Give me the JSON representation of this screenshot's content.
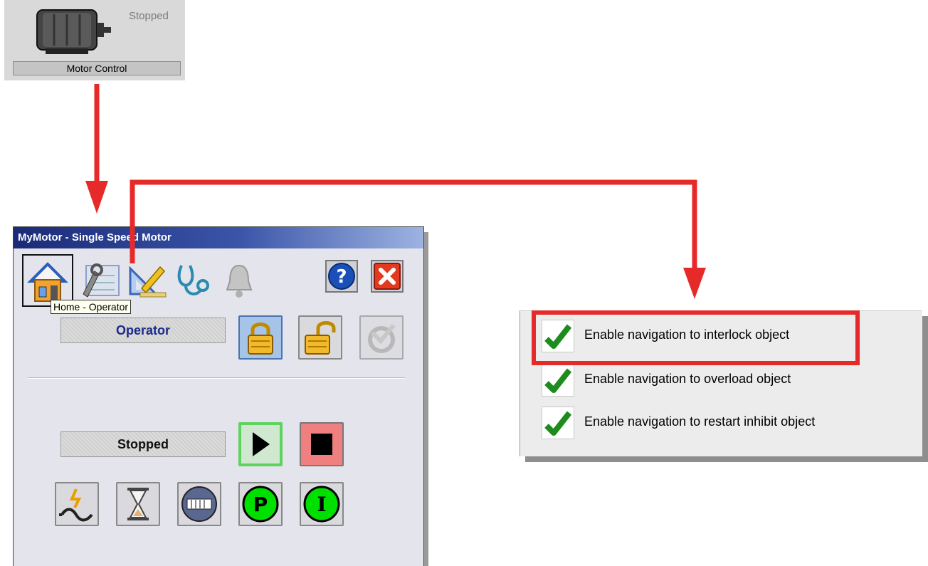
{
  "motor_tile": {
    "status": "Stopped",
    "label": "Motor Control"
  },
  "faceplate": {
    "title": "MyMotor - Single Speed Motor",
    "tabs": [
      {
        "name": "home-icon"
      },
      {
        "name": "maintenance-icon"
      },
      {
        "name": "engineering-icon"
      },
      {
        "name": "diagnostics-icon"
      },
      {
        "name": "alarm-bell-icon"
      }
    ],
    "help_icon": "question-mark-icon",
    "close_icon": "close-icon",
    "tooltip": "Home - Operator",
    "mode_field": "Operator",
    "state_field": "Stopped",
    "colors": {
      "title_start": "#1b2a77",
      "field_text": "#1b2a8a",
      "start_button_border": "#5fd35f",
      "stop_button_bg": "#f08080",
      "status_green": "#00e000"
    }
  },
  "config_panel": {
    "options": [
      {
        "label": "Enable navigation to interlock object",
        "checked": true
      },
      {
        "label": "Enable navigation to overload object",
        "checked": true
      },
      {
        "label": "Enable navigation to restart inhibit object",
        "checked": true
      }
    ],
    "highlight_color": "#e62a2a",
    "check_color": "#1e8b1e"
  }
}
